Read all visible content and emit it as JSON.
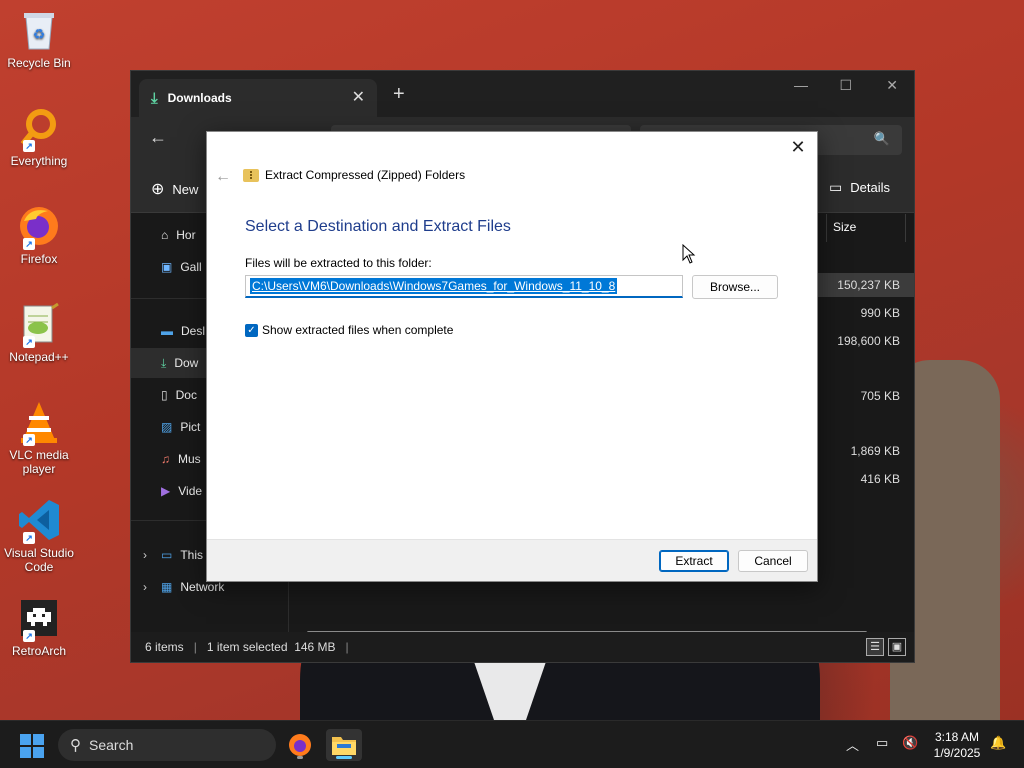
{
  "desktop": {
    "icons": [
      {
        "label": "Recycle Bin",
        "icon": "recycle-bin-icon"
      },
      {
        "label": "Everything",
        "icon": "everything-search-icon"
      },
      {
        "label": "Firefox",
        "icon": "firefox-icon"
      },
      {
        "label": "Notepad++",
        "icon": "notepadpp-icon"
      },
      {
        "label": "VLC media player",
        "icon": "vlc-icon"
      },
      {
        "label": "Visual Studio Code",
        "icon": "vscode-icon"
      },
      {
        "label": "RetroArch",
        "icon": "retroarch-icon"
      }
    ]
  },
  "explorer": {
    "tab_title": "Downloads",
    "new_label": "New",
    "details_label": "Details",
    "column_size": "Size",
    "sidebar": [
      {
        "label": "Hor",
        "icon": "home-icon"
      },
      {
        "label": "Gall",
        "icon": "gallery-icon"
      },
      {
        "label": "Desl",
        "icon": "desktop-icon"
      },
      {
        "label": "Dow",
        "icon": "downloads-icon"
      },
      {
        "label": "Doc",
        "icon": "documents-icon"
      },
      {
        "label": "Pict",
        "icon": "pictures-icon"
      },
      {
        "label": "Mus",
        "icon": "music-icon"
      },
      {
        "label": "Vide",
        "icon": "videos-icon"
      },
      {
        "label": "This",
        "icon": "this-pc-icon"
      },
      {
        "label": "Network",
        "icon": "network-icon"
      }
    ],
    "sizes": [
      "150,237 KB",
      "990 KB",
      "198,600 KB",
      "705 KB",
      "1,869 KB",
      "416 KB"
    ],
    "status": {
      "items": "6 items",
      "selected": "1 item selected  146 MB"
    }
  },
  "dialog": {
    "title": "Extract Compressed (Zipped) Folders",
    "heading": "Select a Destination and Extract Files",
    "label": "Files will be extracted to this folder:",
    "path": "C:\\Users\\VM6\\Downloads\\Windows7Games_for_Windows_11_10_8",
    "browse": "Browse...",
    "checkbox_label": "Show extracted files when complete",
    "checkbox_checked": true,
    "extract": "Extract",
    "cancel": "Cancel"
  },
  "taskbar": {
    "search_placeholder": "Search",
    "time": "3:18 AM",
    "date": "1/9/2025"
  },
  "colors": {
    "accent": "#0067c0",
    "dialog_heading": "#1f3d8c",
    "desktop_red": "#b83a2c"
  }
}
